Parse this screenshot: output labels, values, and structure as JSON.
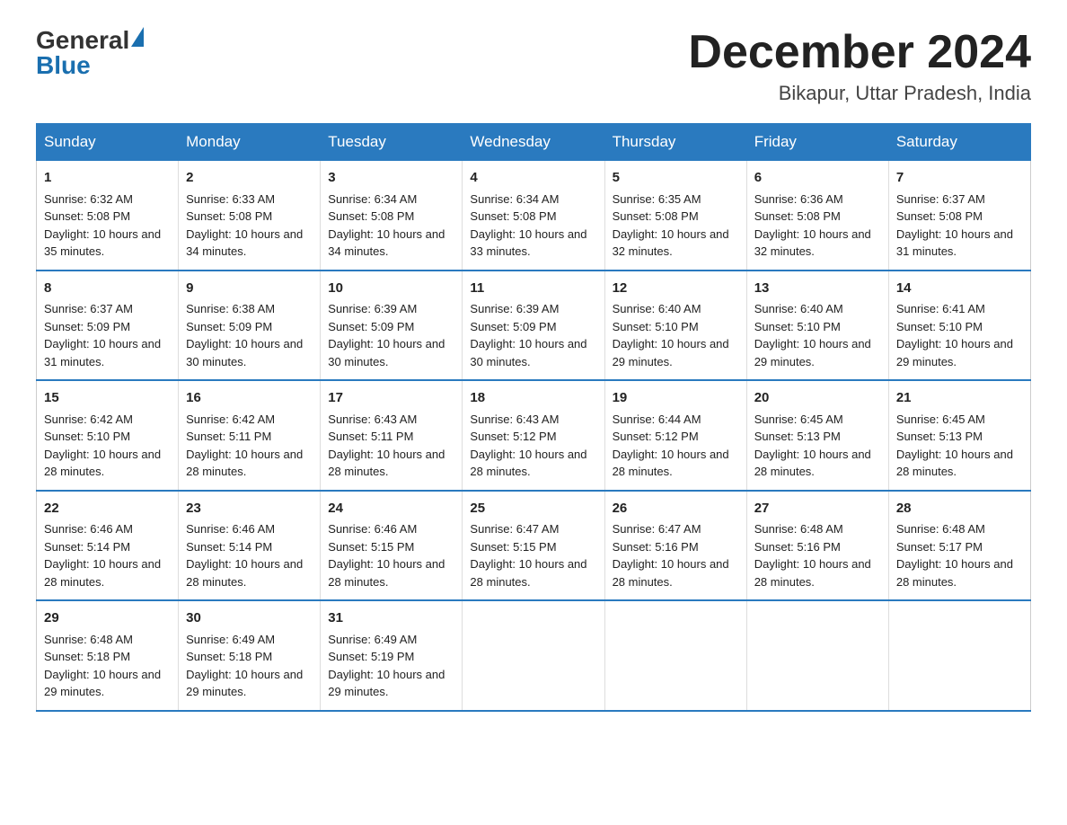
{
  "logo": {
    "general": "General",
    "blue": "Blue"
  },
  "title": "December 2024",
  "location": "Bikapur, Uttar Pradesh, India",
  "days_of_week": [
    "Sunday",
    "Monday",
    "Tuesday",
    "Wednesday",
    "Thursday",
    "Friday",
    "Saturday"
  ],
  "weeks": [
    [
      {
        "day": 1,
        "sunrise": "6:32 AM",
        "sunset": "5:08 PM",
        "daylight": "10 hours and 35 minutes."
      },
      {
        "day": 2,
        "sunrise": "6:33 AM",
        "sunset": "5:08 PM",
        "daylight": "10 hours and 34 minutes."
      },
      {
        "day": 3,
        "sunrise": "6:34 AM",
        "sunset": "5:08 PM",
        "daylight": "10 hours and 34 minutes."
      },
      {
        "day": 4,
        "sunrise": "6:34 AM",
        "sunset": "5:08 PM",
        "daylight": "10 hours and 33 minutes."
      },
      {
        "day": 5,
        "sunrise": "6:35 AM",
        "sunset": "5:08 PM",
        "daylight": "10 hours and 32 minutes."
      },
      {
        "day": 6,
        "sunrise": "6:36 AM",
        "sunset": "5:08 PM",
        "daylight": "10 hours and 32 minutes."
      },
      {
        "day": 7,
        "sunrise": "6:37 AM",
        "sunset": "5:08 PM",
        "daylight": "10 hours and 31 minutes."
      }
    ],
    [
      {
        "day": 8,
        "sunrise": "6:37 AM",
        "sunset": "5:09 PM",
        "daylight": "10 hours and 31 minutes."
      },
      {
        "day": 9,
        "sunrise": "6:38 AM",
        "sunset": "5:09 PM",
        "daylight": "10 hours and 30 minutes."
      },
      {
        "day": 10,
        "sunrise": "6:39 AM",
        "sunset": "5:09 PM",
        "daylight": "10 hours and 30 minutes."
      },
      {
        "day": 11,
        "sunrise": "6:39 AM",
        "sunset": "5:09 PM",
        "daylight": "10 hours and 30 minutes."
      },
      {
        "day": 12,
        "sunrise": "6:40 AM",
        "sunset": "5:10 PM",
        "daylight": "10 hours and 29 minutes."
      },
      {
        "day": 13,
        "sunrise": "6:40 AM",
        "sunset": "5:10 PM",
        "daylight": "10 hours and 29 minutes."
      },
      {
        "day": 14,
        "sunrise": "6:41 AM",
        "sunset": "5:10 PM",
        "daylight": "10 hours and 29 minutes."
      }
    ],
    [
      {
        "day": 15,
        "sunrise": "6:42 AM",
        "sunset": "5:10 PM",
        "daylight": "10 hours and 28 minutes."
      },
      {
        "day": 16,
        "sunrise": "6:42 AM",
        "sunset": "5:11 PM",
        "daylight": "10 hours and 28 minutes."
      },
      {
        "day": 17,
        "sunrise": "6:43 AM",
        "sunset": "5:11 PM",
        "daylight": "10 hours and 28 minutes."
      },
      {
        "day": 18,
        "sunrise": "6:43 AM",
        "sunset": "5:12 PM",
        "daylight": "10 hours and 28 minutes."
      },
      {
        "day": 19,
        "sunrise": "6:44 AM",
        "sunset": "5:12 PM",
        "daylight": "10 hours and 28 minutes."
      },
      {
        "day": 20,
        "sunrise": "6:45 AM",
        "sunset": "5:13 PM",
        "daylight": "10 hours and 28 minutes."
      },
      {
        "day": 21,
        "sunrise": "6:45 AM",
        "sunset": "5:13 PM",
        "daylight": "10 hours and 28 minutes."
      }
    ],
    [
      {
        "day": 22,
        "sunrise": "6:46 AM",
        "sunset": "5:14 PM",
        "daylight": "10 hours and 28 minutes."
      },
      {
        "day": 23,
        "sunrise": "6:46 AM",
        "sunset": "5:14 PM",
        "daylight": "10 hours and 28 minutes."
      },
      {
        "day": 24,
        "sunrise": "6:46 AM",
        "sunset": "5:15 PM",
        "daylight": "10 hours and 28 minutes."
      },
      {
        "day": 25,
        "sunrise": "6:47 AM",
        "sunset": "5:15 PM",
        "daylight": "10 hours and 28 minutes."
      },
      {
        "day": 26,
        "sunrise": "6:47 AM",
        "sunset": "5:16 PM",
        "daylight": "10 hours and 28 minutes."
      },
      {
        "day": 27,
        "sunrise": "6:48 AM",
        "sunset": "5:16 PM",
        "daylight": "10 hours and 28 minutes."
      },
      {
        "day": 28,
        "sunrise": "6:48 AM",
        "sunset": "5:17 PM",
        "daylight": "10 hours and 28 minutes."
      }
    ],
    [
      {
        "day": 29,
        "sunrise": "6:48 AM",
        "sunset": "5:18 PM",
        "daylight": "10 hours and 29 minutes."
      },
      {
        "day": 30,
        "sunrise": "6:49 AM",
        "sunset": "5:18 PM",
        "daylight": "10 hours and 29 minutes."
      },
      {
        "day": 31,
        "sunrise": "6:49 AM",
        "sunset": "5:19 PM",
        "daylight": "10 hours and 29 minutes."
      },
      null,
      null,
      null,
      null
    ]
  ]
}
